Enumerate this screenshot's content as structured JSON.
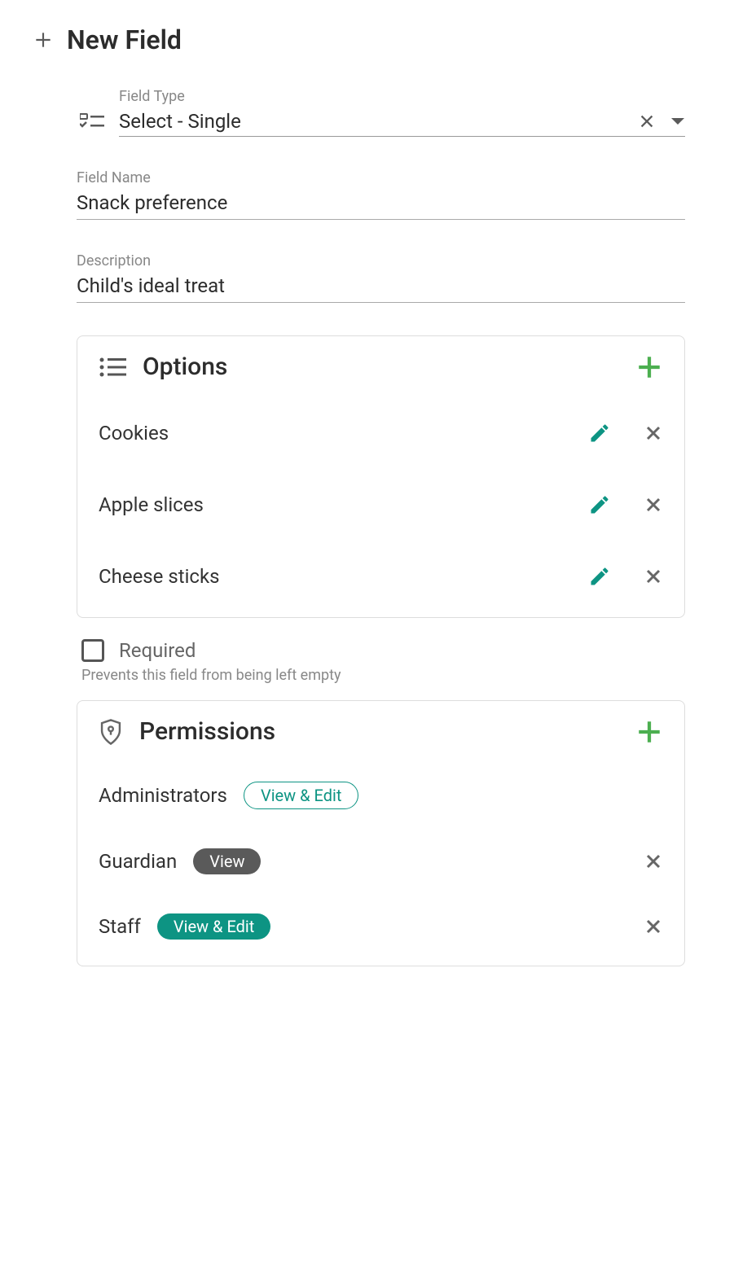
{
  "header": {
    "title": "New Field"
  },
  "fieldType": {
    "label": "Field Type",
    "value": "Select - Single"
  },
  "fieldName": {
    "label": "Field Name",
    "value": "Snack preference"
  },
  "description": {
    "label": "Description",
    "value": "Child's ideal treat"
  },
  "options": {
    "heading": "Options",
    "items": [
      {
        "label": "Cookies"
      },
      {
        "label": "Apple slices"
      },
      {
        "label": "Cheese sticks"
      }
    ]
  },
  "required": {
    "label": "Required",
    "help": "Prevents this field from being left empty",
    "checked": false
  },
  "permissions": {
    "heading": "Permissions",
    "items": [
      {
        "role": "Administrators",
        "badge": "View & Edit",
        "badgeStyle": "outline",
        "removable": false
      },
      {
        "role": "Guardian",
        "badge": "View",
        "badgeStyle": "grey",
        "removable": true
      },
      {
        "role": "Staff",
        "badge": "View & Edit",
        "badgeStyle": "teal",
        "removable": true
      }
    ]
  }
}
